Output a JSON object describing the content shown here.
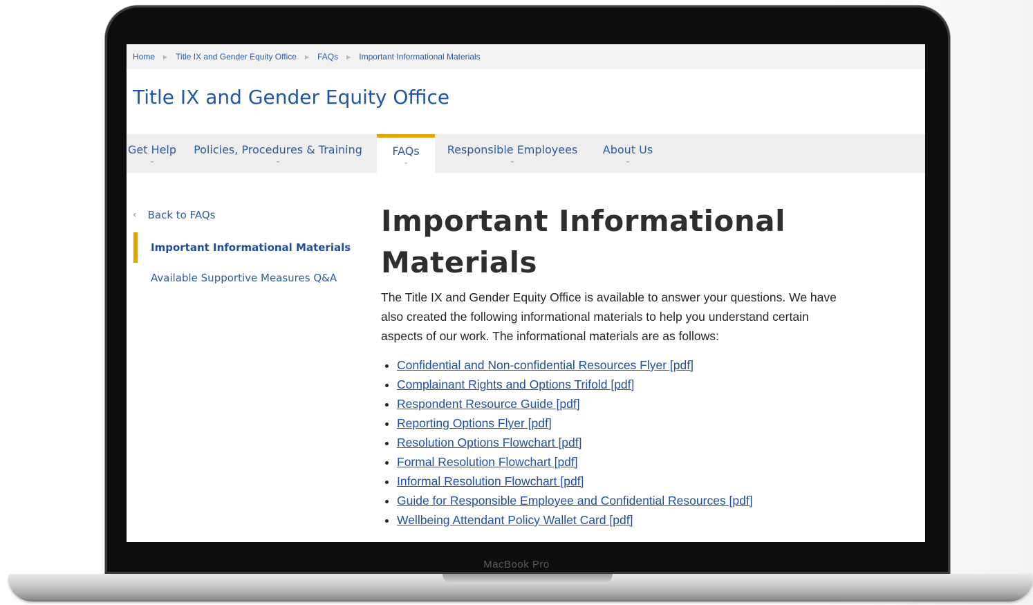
{
  "device": {
    "label": "MacBook Pro"
  },
  "breadcrumb": [
    "Home",
    "Title IX and Gender Equity Office",
    "FAQs",
    "Important Informational Materials"
  ],
  "site": {
    "title": "Title IX and Gender Equity Office"
  },
  "nav": {
    "items": [
      {
        "label": "Get Help",
        "active": false
      },
      {
        "label": "Policies, Procedures & Training",
        "active": false
      },
      {
        "label": "FAQs",
        "active": true
      },
      {
        "label": "Responsible Employees",
        "active": false
      },
      {
        "label": "About Us",
        "active": false
      }
    ],
    "chevron_icon": "chevron-down-icon"
  },
  "sidebar": {
    "back_label": "Back to FAQs",
    "items": [
      {
        "label": "Important Informational Materials",
        "active": true
      },
      {
        "label": "Available Supportive Measures Q&A",
        "active": false
      }
    ]
  },
  "main": {
    "title_line1": "Important Informational",
    "title_line2": "Materials",
    "intro": "The Title IX and Gender Equity Office is available to answer your questions. We have also created the following informational materials to help you understand certain aspects of our work. The informational materials are as follows:",
    "links": [
      "Confidential and Non-confidential Resources Flyer [pdf]",
      "Complainant Rights and Options Trifold  [pdf]",
      "Respondent Resource Guide [pdf]",
      "Reporting Options Flyer [pdf]",
      "Resolution Options Flowchart [pdf]",
      "Formal Resolution Flowchart [pdf]",
      "Informal Resolution Flowchart [pdf]",
      "Guide for Responsible Employee and Confidential Resources [pdf]",
      "Wellbeing Attendant Policy Wallet Card [pdf]"
    ]
  },
  "colors": {
    "accent": "#e6a100",
    "link": "#1f4fa6",
    "title": "#1f57a6"
  }
}
